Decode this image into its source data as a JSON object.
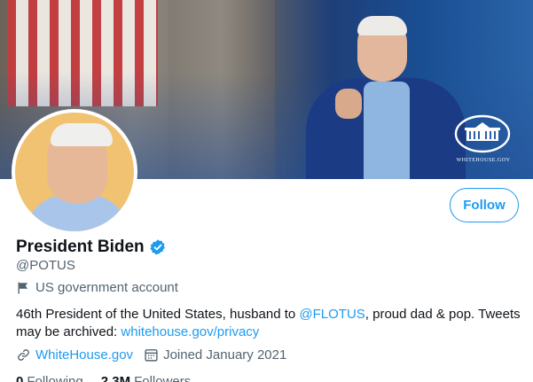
{
  "banner": {
    "caption": "WHITEHOUSE.GOV"
  },
  "profile": {
    "display_name": "President Biden",
    "handle": "@POTUS",
    "account_label": "US government account",
    "bio": {
      "part1": "46th President of the United States, husband to ",
      "mention": "@FLOTUS",
      "part2": ", proud dad & pop. Tweets may be archived: ",
      "archive_link": "whitehouse.gov/privacy"
    },
    "website": "WhiteHouse.gov",
    "joined": "Joined January 2021",
    "following_count": "0",
    "following_label": "Following",
    "followers_count": "2.3M",
    "followers_label": "Followers"
  },
  "actions": {
    "follow_label": "Follow"
  },
  "colors": {
    "accent": "#1d9bf0",
    "secondary_text": "#536471",
    "primary_text": "#0f1419"
  },
  "icons": [
    "flag-icon",
    "link-icon",
    "calendar-icon",
    "verified-badge-icon",
    "whitehouse-logo-icon"
  ]
}
